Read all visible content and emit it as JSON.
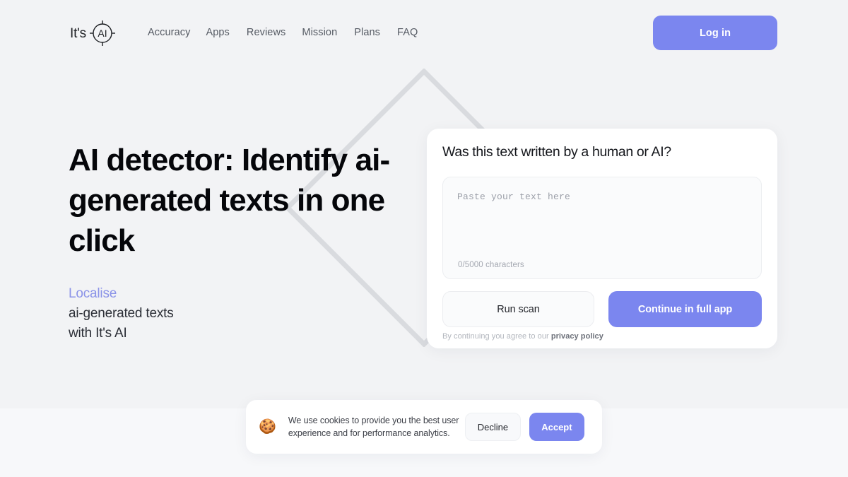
{
  "brand": {
    "logo_word": "It's",
    "logo_mark_text": "AI",
    "accent_color": "#7b86ef",
    "accent_text_color": "#8b93e8"
  },
  "header": {
    "nav": [
      {
        "label": "Accuracy"
      },
      {
        "label": "Apps"
      },
      {
        "label": "Reviews"
      },
      {
        "label": "Mission"
      },
      {
        "label": "Plans"
      },
      {
        "label": "FAQ"
      }
    ],
    "login_label": "Log in"
  },
  "hero": {
    "title": "AI detector: Identify ai-generated texts in one click",
    "sub_accent": "Localise",
    "sub_line1": "ai-generated texts",
    "sub_line2": "with It's AI"
  },
  "scanner": {
    "title": "Was this text written by a human or AI?",
    "textarea_placeholder": "Paste your text here",
    "textarea_value": "",
    "char_count": "0/5000 characters",
    "run_scan_label": "Run scan",
    "continue_label": "Continue in full app",
    "privacy_prefix": "By continuing you agree to our ",
    "privacy_link_label": "privacy policy"
  },
  "cookie_banner": {
    "emoji": "🍪",
    "message": "We use cookies to provide you the best user experience and for performance analytics.",
    "decline_label": "Decline",
    "accept_label": "Accept"
  }
}
